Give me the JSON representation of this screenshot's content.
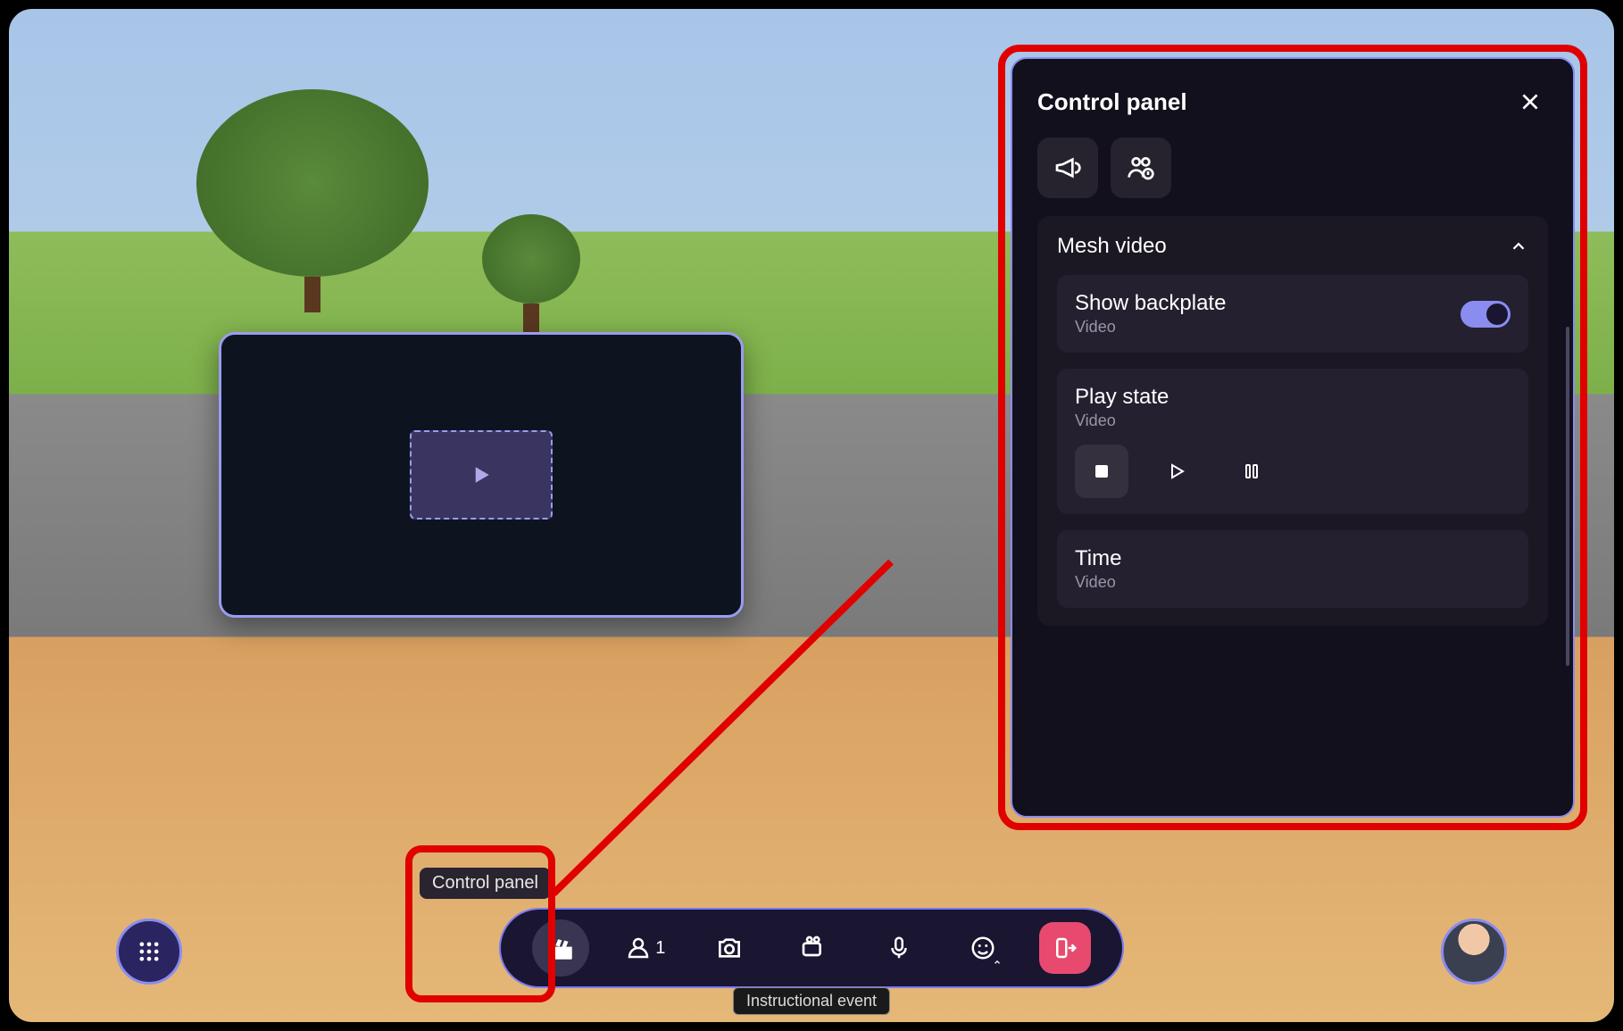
{
  "tooltip": "Control panel",
  "caption": "Instructional event",
  "toolbar": {
    "people_count": "1"
  },
  "panel": {
    "title": "Control panel",
    "section_title": "Mesh video",
    "backplate": {
      "title": "Show backplate",
      "sub": "Video"
    },
    "playstate": {
      "title": "Play state",
      "sub": "Video"
    },
    "time": {
      "title": "Time",
      "sub": "Video"
    }
  }
}
